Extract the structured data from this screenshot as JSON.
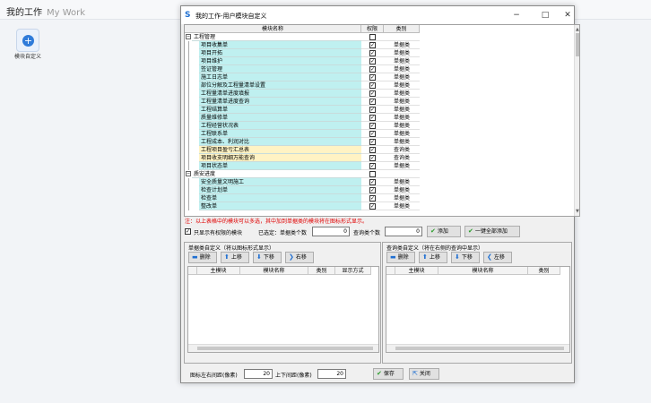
{
  "header": {
    "title": "我的工作",
    "subtitle": "My Work"
  },
  "tile": {
    "label": "模块自定义"
  },
  "dialog": {
    "title": "我的工作-用户模块自定义",
    "tree": {
      "columns": [
        "模块名称",
        "权限",
        "类别"
      ],
      "rows": [
        {
          "name": "工程管理",
          "level": 0,
          "expand": "−",
          "checked": false,
          "category": "",
          "color": "#ffffff"
        },
        {
          "name": "项目收集单",
          "level": 1,
          "checked": true,
          "category": "单据类",
          "color": "#bff0f0"
        },
        {
          "name": "项目开拓",
          "level": 1,
          "checked": true,
          "category": "单据类",
          "color": "#bff0f0"
        },
        {
          "name": "项目维护",
          "level": 1,
          "checked": true,
          "category": "单据类",
          "color": "#bff0f0"
        },
        {
          "name": "签证管理",
          "level": 1,
          "checked": true,
          "category": "单据类",
          "color": "#bff0f0"
        },
        {
          "name": "施工日志单",
          "level": 1,
          "checked": true,
          "category": "单据类",
          "color": "#bff0f0"
        },
        {
          "name": "部位分解及工程量清单设置",
          "level": 1,
          "checked": true,
          "category": "单据类",
          "color": "#bff0f0"
        },
        {
          "name": "工程量清单进度填报",
          "level": 1,
          "checked": true,
          "category": "单据类",
          "color": "#bff0f0"
        },
        {
          "name": "工程量清单进度查询",
          "level": 1,
          "checked": true,
          "category": "单据类",
          "color": "#bff0f0"
        },
        {
          "name": "工程结算单",
          "level": 1,
          "checked": true,
          "category": "单据类",
          "color": "#bff0f0"
        },
        {
          "name": "质量维修单",
          "level": 1,
          "checked": true,
          "category": "单据类",
          "color": "#bff0f0"
        },
        {
          "name": "工程经营状况表",
          "level": 1,
          "checked": true,
          "category": "单据类",
          "color": "#bff0f0"
        },
        {
          "name": "工程联系单",
          "level": 1,
          "checked": true,
          "category": "单据类",
          "color": "#bff0f0"
        },
        {
          "name": "工程成本、利润对比",
          "level": 1,
          "checked": true,
          "category": "单据类",
          "color": "#bff0f0"
        },
        {
          "name": "工程项目盈亏汇总表",
          "level": 1,
          "checked": true,
          "category": "查询类",
          "color": "#fff3c4"
        },
        {
          "name": "项目收支明细万能查询",
          "level": 1,
          "checked": true,
          "category": "查询类",
          "color": "#fff3c4"
        },
        {
          "name": "项目状态单",
          "level": 1,
          "checked": true,
          "category": "单据类",
          "color": "#bff0f0"
        },
        {
          "name": "质安进度",
          "level": 0,
          "expand": "−",
          "checked": false,
          "category": "",
          "color": "#ffffff"
        },
        {
          "name": "安全质量文明施工",
          "level": 1,
          "checked": true,
          "category": "单据类",
          "color": "#bff0f0"
        },
        {
          "name": "检查计划单",
          "level": 1,
          "checked": true,
          "category": "单据类",
          "color": "#bff0f0"
        },
        {
          "name": "检查单",
          "level": 1,
          "checked": true,
          "category": "单据类",
          "color": "#bff0f0"
        },
        {
          "name": "整改单",
          "level": 1,
          "checked": true,
          "category": "单据类",
          "color": "#bff0f0"
        }
      ]
    },
    "note": "注：以上表格中的模块可以多选，其中加到单据类的模块将在图标形式显示。",
    "controls": {
      "only_show_label": "只显示有权限的模块",
      "selected_label": "已选定：单据类个数",
      "doc_count": "0",
      "query_count_label": "查询类个数",
      "query_count": "0",
      "add": "添加",
      "add_all": "一键全部添加"
    },
    "left_group": {
      "title": "单据类自定义（将以图标形式显示）",
      "buttons": [
        "删除",
        "上移",
        "下移",
        "右移"
      ],
      "columns": [
        "主模块",
        "模块名称",
        "类别",
        "显示方式"
      ]
    },
    "right_group": {
      "title": "查询类自定义（将在右侧的查询中显示）",
      "buttons": [
        "删除",
        "上移",
        "下移",
        "左移"
      ],
      "columns": [
        "主模块",
        "模块名称",
        "类别"
      ]
    },
    "bottom": {
      "lr_label": "图标左右间距(像素)",
      "lr_value": "20",
      "ud_label": "上下间距(像素)",
      "ud_value": "20",
      "save": "保存",
      "close": "关闭"
    }
  }
}
